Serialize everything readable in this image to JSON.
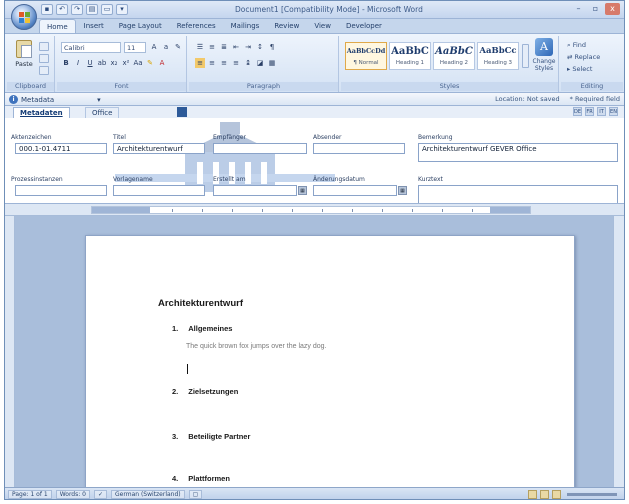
{
  "window": {
    "title": "Document1 [Compatibility Mode] - Microsoft Word",
    "controls": {
      "minimize": "–",
      "maximize": "▫",
      "close": "x"
    }
  },
  "ribbon": {
    "tabs": [
      "Home",
      "Insert",
      "Page Layout",
      "References",
      "Mailings",
      "Review",
      "View",
      "Developer"
    ],
    "clipboard": {
      "paste_label": "Paste",
      "group_label": "Clipboard"
    },
    "font": {
      "font_name": "Calibri",
      "font_size": "11",
      "group_label": "Font"
    },
    "paragraph": {
      "group_label": "Paragraph"
    },
    "styles": {
      "items": [
        {
          "sample": "AaBbCcDd",
          "name": "¶ Normal"
        },
        {
          "sample": "AaBbC",
          "name": "Heading 1"
        },
        {
          "sample": "AaBbC",
          "name": "Heading 2"
        },
        {
          "sample": "AaBbCc",
          "name": "Heading 3"
        }
      ],
      "change_styles_label": "Change Styles",
      "group_label": "Styles"
    },
    "editing": {
      "find": "Find",
      "replace": "Replace",
      "select": "Select",
      "group_label": "Editing"
    }
  },
  "document_info": {
    "panel_label": "Metadata",
    "right_text": "Location: Not saved",
    "required_text": "* Required field"
  },
  "metadata": {
    "tabs": [
      "Metadaten",
      "Office"
    ],
    "fields": {
      "aktenzeichen": {
        "label": "Aktenzeichen",
        "value": "000.1-01.4711"
      },
      "titel": {
        "label": "Titel",
        "value": "Architekturentwurf"
      },
      "empfaenger": {
        "label": "Empfänger",
        "value": ""
      },
      "absender": {
        "label": "Absender",
        "value": ""
      },
      "bemerkung": {
        "label": "Bemerkung",
        "value": "Architekturentwurf GEVER Office"
      },
      "prozesstyp": {
        "label": "Prozessinstanzen",
        "value": ""
      },
      "vorlage": {
        "label": "Vorlagename",
        "value": ""
      },
      "erstellt": {
        "label": "Erstellt am",
        "value": ""
      },
      "aenderung": {
        "label": "Änderungsdatum",
        "value": ""
      },
      "kurztext": {
        "label": "Kurztext",
        "value": ""
      }
    }
  },
  "document": {
    "title": "Architekturentwurf",
    "headings": [
      {
        "number": "1.",
        "text": "Allgemeines"
      },
      {
        "number": "2.",
        "text": "Zielsetzungen"
      },
      {
        "number": "3.",
        "text": "Beteiligte Partner"
      },
      {
        "number": "4.",
        "text": "Plattformen"
      }
    ],
    "body": "The quick brown fox jumps over the lazy dog."
  },
  "statusbar": {
    "page": "Page: 1 of 1",
    "words": "Words: 0",
    "language": "German (Switzerland)"
  }
}
